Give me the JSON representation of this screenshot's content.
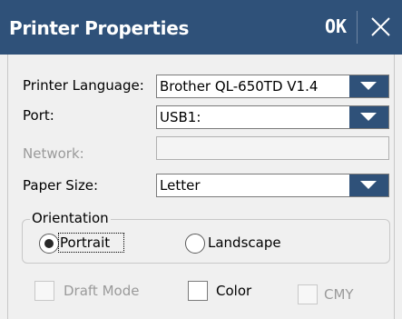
{
  "dialog": {
    "title": "Printer Properties",
    "ok_label": "OK",
    "close_icon": "close-icon"
  },
  "fields": {
    "printer_language": {
      "label": "Printer Language:",
      "value": "Brother QL-650TD V1.4"
    },
    "port": {
      "label": "Port:",
      "value": "USB1:"
    },
    "network": {
      "label": "Network:",
      "value": ""
    },
    "paper_size": {
      "label": "Paper Size:",
      "value": "Letter"
    }
  },
  "orientation": {
    "legend": "Orientation",
    "portrait_label": "Portrait",
    "landscape_label": "Landscape",
    "selected": "Portrait"
  },
  "options": {
    "draft_mode_label": "Draft Mode",
    "color_label": "Color",
    "cmy_label": "CMY"
  },
  "colors": {
    "accent": "#2f5179",
    "background": "#f0f0f0",
    "disabled_text": "#9a9a9a"
  }
}
